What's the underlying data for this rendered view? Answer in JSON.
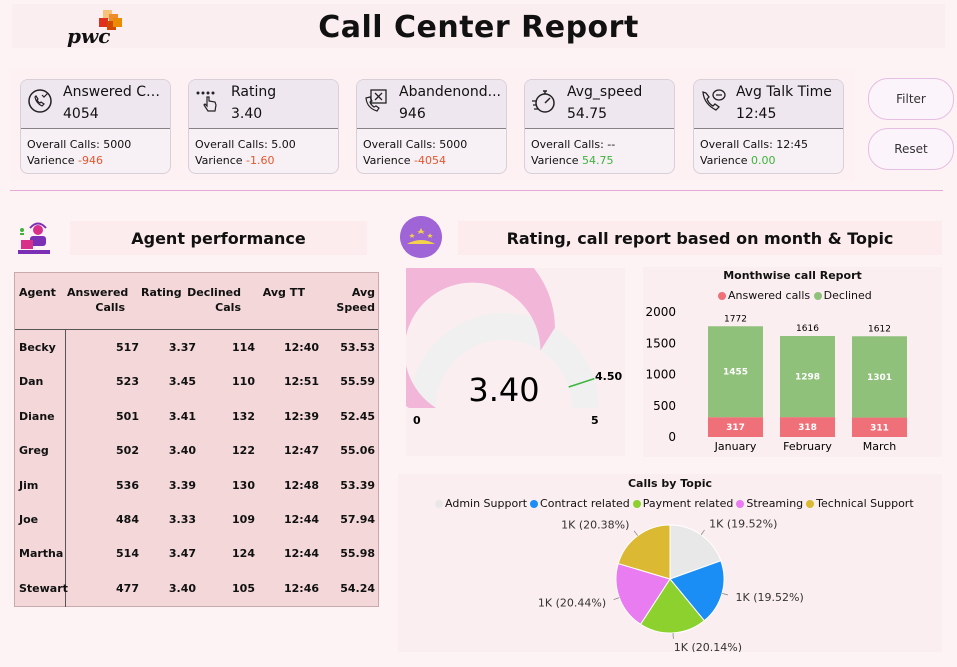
{
  "header": {
    "title": "Call Center Report",
    "logo_text": "pwc"
  },
  "kpis": [
    {
      "icon": "phone-check-icon",
      "name": "Answered Calls",
      "value": "4054",
      "line1_label": "Overall Calls: ",
      "line1_value": "5000",
      "line2_label": "Varience ",
      "line2_value": "-946",
      "line2_color": "#e2572e"
    },
    {
      "icon": "rating-hand-icon",
      "name": "Rating",
      "value": "3.40",
      "line1_label": "Overall Calls: ",
      "line1_value": "5.00",
      "line2_label": "Varience ",
      "line2_value": "-1.60",
      "line2_color": "#e2572e"
    },
    {
      "icon": "phone-cross-icon",
      "name": "Abandenond...",
      "value": "946",
      "line1_label": "Overall Calls: ",
      "line1_value": "5000",
      "line2_label": "Varience ",
      "line2_value": "-4054",
      "line2_color": "#e2572e"
    },
    {
      "icon": "stopwatch-icon",
      "name": "Avg_speed",
      "value": "54.75",
      "line1_label": "Overall Calls: ",
      "line1_value": "--",
      "line2_label": "Varience ",
      "line2_value": "54.75",
      "line2_color": "#3cb43c"
    },
    {
      "icon": "phone-talk-icon",
      "name": "Avg Talk Time",
      "value": "12:45",
      "line1_label": "Overall Calls: ",
      "line1_value": "12:45",
      "line2_label": "Varience ",
      "line2_value": "0.00",
      "line2_color": "#3cb43c"
    }
  ],
  "buttons": {
    "filter": "Filter",
    "reset": "Reset"
  },
  "agent_section": {
    "title": "Agent performance",
    "columns": [
      "Agent",
      "Answered\nCalls",
      "Rating",
      "Declined\nCals",
      "Avg TT",
      "Avg Speed"
    ],
    "rows": [
      [
        "Becky",
        "517",
        "3.37",
        "114",
        "12:40",
        "53.53"
      ],
      [
        "Dan",
        "523",
        "3.45",
        "110",
        "12:51",
        "55.59"
      ],
      [
        "Diane",
        "501",
        "3.41",
        "132",
        "12:39",
        "52.45"
      ],
      [
        "Greg",
        "502",
        "3.40",
        "122",
        "12:47",
        "55.06"
      ],
      [
        "Jim",
        "536",
        "3.39",
        "130",
        "12:48",
        "53.39"
      ],
      [
        "Joe",
        "484",
        "3.33",
        "109",
        "12:44",
        "57.94"
      ],
      [
        "Martha",
        "514",
        "3.47",
        "124",
        "12:44",
        "55.98"
      ],
      [
        "Stewart",
        "477",
        "3.40",
        "105",
        "12:46",
        "54.24"
      ]
    ]
  },
  "rating_section": {
    "title": "Rating, call report based on month & Topic"
  },
  "colors": {
    "answered": "#8fc17a",
    "declined": "#f07079",
    "gauge_fill": "#f2b6d8",
    "gauge_bg": "#f0f0f0",
    "target": "#3cb43c"
  },
  "chart_data": [
    {
      "type": "gauge",
      "title": "Rating",
      "value": 3.4,
      "value_label": "3.40",
      "min": 0,
      "max": 5,
      "target": 4.5,
      "min_label": "0",
      "max_label": "5",
      "target_label": "4.50"
    },
    {
      "type": "bar",
      "stacked": true,
      "title": "Monthwise call Report",
      "categories": [
        "January",
        "February",
        "March"
      ],
      "series": [
        {
          "name": "Answered calls",
          "values": [
            1455,
            1298,
            1301
          ],
          "labels": [
            "1455",
            "1298",
            "1301"
          ]
        },
        {
          "name": "Declined",
          "values": [
            317,
            318,
            311
          ],
          "labels": [
            "317",
            "318",
            "311"
          ]
        }
      ],
      "totals": [
        1772,
        1616,
        1612
      ],
      "total_labels": [
        "1772",
        "1616",
        "1612"
      ],
      "ylim": [
        0,
        2000
      ],
      "yticks": [
        "2000",
        "1500",
        "1000",
        "500",
        "0"
      ],
      "legend": "top"
    },
    {
      "type": "pie",
      "title": "Calls by Topic",
      "categories": [
        "Admin Support",
        "Contract related",
        "Payment related",
        "Streaming",
        "Technical Support"
      ],
      "values": [
        19.52,
        19.52,
        20.14,
        20.44,
        20.38
      ],
      "labels": [
        "1K (19.52%)",
        "1K (19.52%)",
        "1K (20.14%)",
        "1K (20.44%)",
        "1K (20.38%)"
      ],
      "colors": [
        "#e8e8e8",
        "#1b8ef5",
        "#8dd12e",
        "#e97cf0",
        "#dbb932"
      ],
      "legend": "top"
    }
  ]
}
